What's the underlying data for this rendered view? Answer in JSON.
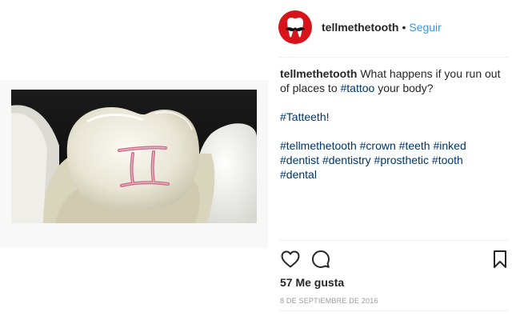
{
  "post": {
    "username": "tellmethetooth",
    "separator": "•",
    "follow_label": "Seguir",
    "caption": {
      "username": "tellmethetooth",
      "text_before": " What happens if you run out of places to ",
      "tag_tattoo": "#tattoo",
      "text_after": " your body?",
      "tag_tatteeth": "#Tatteeth!",
      "tags": [
        "#tellmethetooth",
        "#crown",
        "#teeth",
        "#inked",
        "#dentist",
        "#dentistry",
        "#prosthetic",
        "#tooth",
        "#dental"
      ]
    },
    "likes": "57 Me gusta",
    "date": "8 DE SEPTIEMBRE DE 2016"
  },
  "icons": {
    "avatar": "tooth-mustache-logo-icon",
    "like": "heart-icon",
    "comment": "comment-bubble-icon",
    "save": "bookmark-icon"
  },
  "colors": {
    "link": "#3897f0",
    "hashtag": "#003569",
    "avatar_bg": "#d7141a",
    "muted": "#999999",
    "text": "#262626"
  }
}
